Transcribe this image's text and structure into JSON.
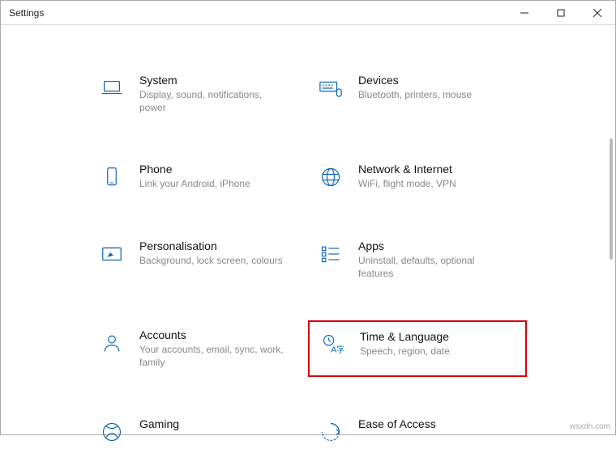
{
  "window": {
    "title": "Settings"
  },
  "accent_color": "#0a63b7",
  "highlight_color": "#d8000c",
  "categories": [
    {
      "id": "system",
      "title": "System",
      "desc": "Display, sound, notifications, power",
      "icon": "laptop-icon"
    },
    {
      "id": "devices",
      "title": "Devices",
      "desc": "Bluetooth, printers, mouse",
      "icon": "keyboard-mouse-icon"
    },
    {
      "id": "phone",
      "title": "Phone",
      "desc": "Link your Android, iPhone",
      "icon": "phone-icon"
    },
    {
      "id": "network",
      "title": "Network & Internet",
      "desc": "WiFi, flight mode, VPN",
      "icon": "globe-icon"
    },
    {
      "id": "personalisation",
      "title": "Personalisation",
      "desc": "Background, lock screen, colours",
      "icon": "pen-icon"
    },
    {
      "id": "apps",
      "title": "Apps",
      "desc": "Uninstall, defaults, optional features",
      "icon": "apps-list-icon"
    },
    {
      "id": "accounts",
      "title": "Accounts",
      "desc": "Your accounts, email, sync, work, family",
      "icon": "person-icon"
    },
    {
      "id": "time-language",
      "title": "Time & Language",
      "desc": "Speech, region, date",
      "icon": "time-language-icon",
      "highlighted": true
    },
    {
      "id": "gaming",
      "title": "Gaming",
      "desc": "",
      "icon": "xbox-icon"
    },
    {
      "id": "ease-of-access",
      "title": "Ease of Access",
      "desc": "",
      "icon": "ease-of-access-icon"
    }
  ],
  "watermark": "wsxdn.com"
}
